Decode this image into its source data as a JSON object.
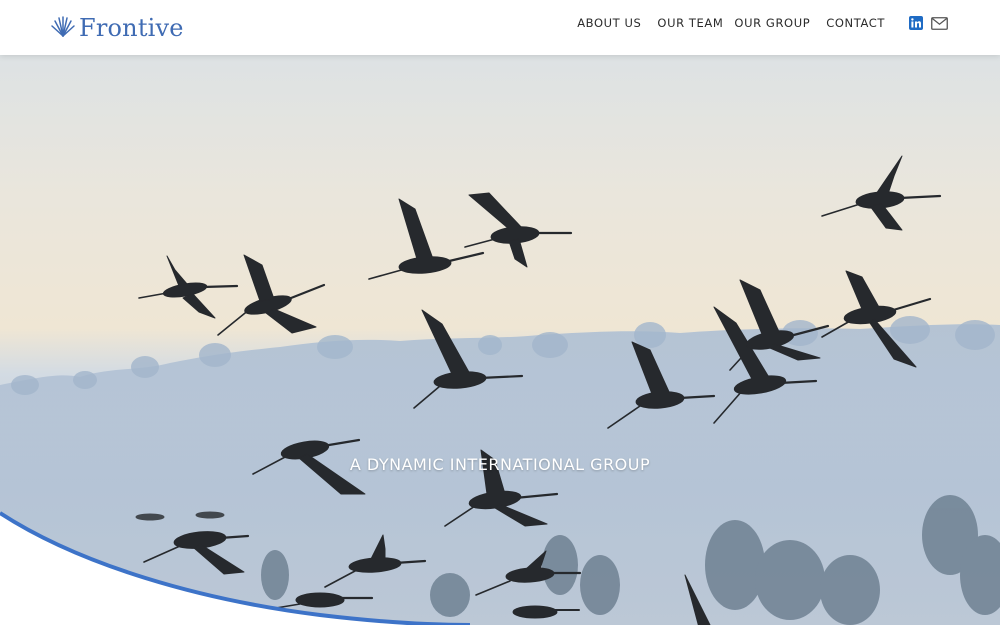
{
  "brand": {
    "name": "Frontive",
    "logo_icon": "fan-leaf-icon",
    "color": "#3f6bb3"
  },
  "nav": {
    "items": [
      "ABOUT US",
      "OUR TEAM",
      "OUR GROUP",
      "CONTACT"
    ],
    "icons": [
      "linkedin-icon",
      "mail-icon"
    ]
  },
  "hero": {
    "tagline": "A DYNAMIC INTERNATIONAL GROUP",
    "image": "flock-of-cranes-in-flight",
    "accent_curve_color": "#3d73c8"
  }
}
